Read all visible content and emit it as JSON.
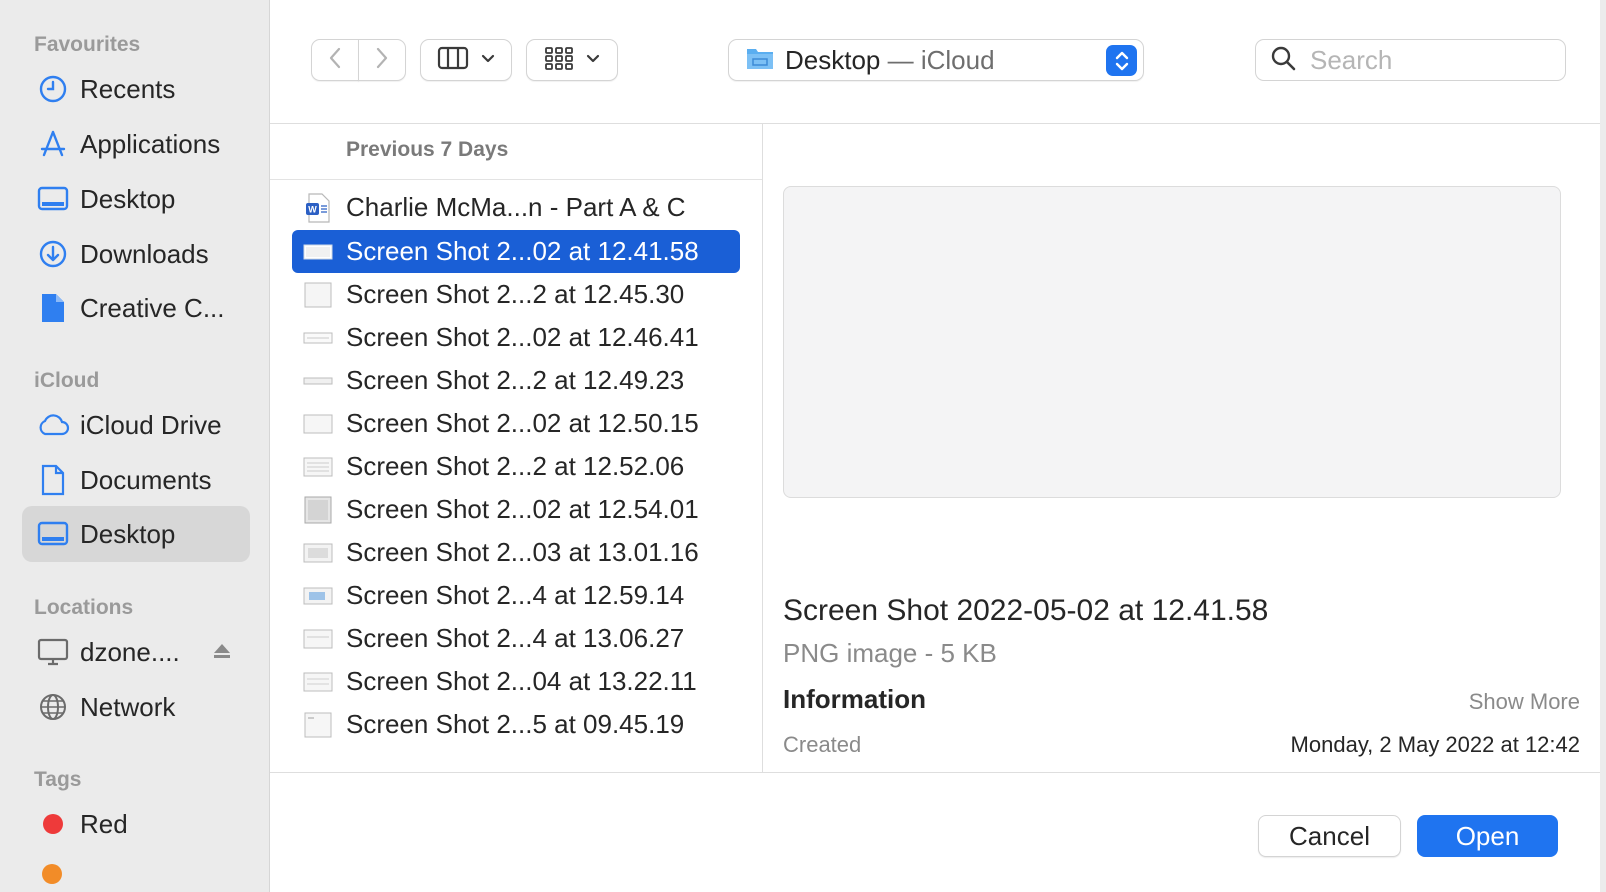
{
  "sidebar": {
    "favourites_heading": "Favourites",
    "favourites": [
      {
        "label": "Recents",
        "icon": "clock-icon"
      },
      {
        "label": "Applications",
        "icon": "applications-icon"
      },
      {
        "label": "Desktop",
        "icon": "desktop-icon"
      },
      {
        "label": "Downloads",
        "icon": "download-icon"
      },
      {
        "label": "Creative C...",
        "icon": "document-icon"
      }
    ],
    "icloud_heading": "iCloud",
    "icloud": [
      {
        "label": "iCloud Drive",
        "icon": "cloud-icon"
      },
      {
        "label": "Documents",
        "icon": "document-icon"
      },
      {
        "label": "Desktop",
        "icon": "desktop-icon",
        "selected": true
      }
    ],
    "locations_heading": "Locations",
    "locations": [
      {
        "label": "dzone....",
        "icon": "computer-icon"
      },
      {
        "label": "Network",
        "icon": "globe-icon"
      }
    ],
    "tags_heading": "Tags",
    "tags": [
      {
        "label": "Red",
        "color": "#ee3a3a"
      }
    ]
  },
  "toolbar": {
    "location_name": "Desktop",
    "location_sub": " — iCloud",
    "search_placeholder": "Search"
  },
  "file_list": {
    "group_header": "Previous 7 Days",
    "files": [
      {
        "name": "Charlie McMa...n - Part A & C",
        "icon": "word-document-icon"
      },
      {
        "name": "Screen Shot 2...02 at 12.41.58",
        "icon": "image-thumbnail-icon",
        "selected": true
      },
      {
        "name": "Screen Shot 2...2 at 12.45.30",
        "icon": "image-thumbnail-icon"
      },
      {
        "name": "Screen Shot 2...02 at 12.46.41",
        "icon": "image-thumbnail-icon"
      },
      {
        "name": "Screen Shot 2...2 at 12.49.23",
        "icon": "image-thumbnail-icon"
      },
      {
        "name": "Screen Shot 2...02 at 12.50.15",
        "icon": "image-thumbnail-icon"
      },
      {
        "name": "Screen Shot 2...2 at 12.52.06",
        "icon": "image-thumbnail-icon"
      },
      {
        "name": "Screen Shot 2...02 at 12.54.01",
        "icon": "image-thumbnail-icon"
      },
      {
        "name": "Screen Shot 2...03 at 13.01.16",
        "icon": "image-thumbnail-icon"
      },
      {
        "name": "Screen Shot 2...4 at 12.59.14",
        "icon": "image-thumbnail-icon"
      },
      {
        "name": "Screen Shot 2...4 at 13.06.27",
        "icon": "image-thumbnail-icon"
      },
      {
        "name": "Screen Shot 2...04 at 13.22.11",
        "icon": "image-thumbnail-icon"
      },
      {
        "name": "Screen Shot 2...5 at 09.45.19",
        "icon": "image-thumbnail-icon"
      }
    ]
  },
  "preview": {
    "title": "Screen Shot 2022-05-02 at 12.41.58",
    "kind": "PNG image - 5 KB",
    "info_heading": "Information",
    "show_more": "Show More",
    "created_label": "Created",
    "created_value": "Monday, 2 May 2022 at 12:42"
  },
  "buttons": {
    "cancel": "Cancel",
    "open": "Open"
  },
  "colors": {
    "accent": "#1f74f0",
    "selection": "#1a5fd6",
    "sidebar_icon": "#2f7ff0"
  }
}
